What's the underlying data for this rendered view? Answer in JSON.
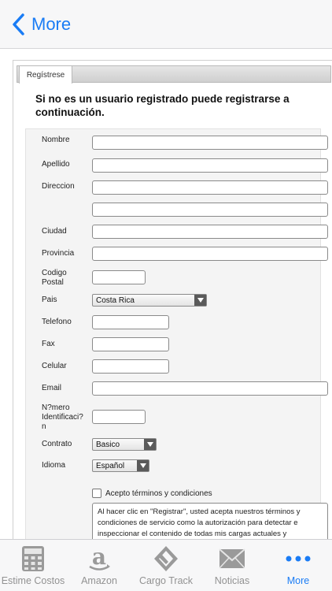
{
  "nav": {
    "back_label": "More"
  },
  "page": {
    "tab_label": "Regístrese",
    "heading_line1": "Si no es un usuario registrado puede registrarse a",
    "heading_line2": "continuación."
  },
  "form": {
    "nombre": "Nombre",
    "apellido": "Apellido",
    "direccion": "Direccion",
    "ciudad": "Ciudad",
    "provincia": "Provincia",
    "codigo_postal_1": "Codigo",
    "codigo_postal_2": "Postal",
    "pais": "Pais",
    "pais_value": "Costa Rica",
    "telefono": "Telefono",
    "fax": "Fax",
    "celular": "Celular",
    "email": "Email",
    "id_1": "N?mero",
    "id_2": "Identificaci?",
    "id_3": "n",
    "contrato": "Contrato",
    "contrato_value": "Basico",
    "idioma": "Idioma",
    "idioma_value": "Español",
    "accept_label": "Acepto términos y condiciones",
    "terms_text": "Al hacer clic en \"Registrar\", usted acepta nuestros términos y condiciones de servicio como la autorización para detectar e inspeccionar el contenido de todas mis cargas actuales y"
  },
  "tabs": [
    {
      "label": "Estime Costos",
      "icon": "calculator-icon"
    },
    {
      "label": "Amazon",
      "icon": "amazon-icon"
    },
    {
      "label": "Cargo Track",
      "icon": "cargo-track-icon"
    },
    {
      "label": "Noticias",
      "icon": "envelope-icon"
    },
    {
      "label": "More",
      "icon": "more-dots-icon"
    }
  ],
  "colors": {
    "accent": "#1a7cf5",
    "inactive": "#929292"
  }
}
